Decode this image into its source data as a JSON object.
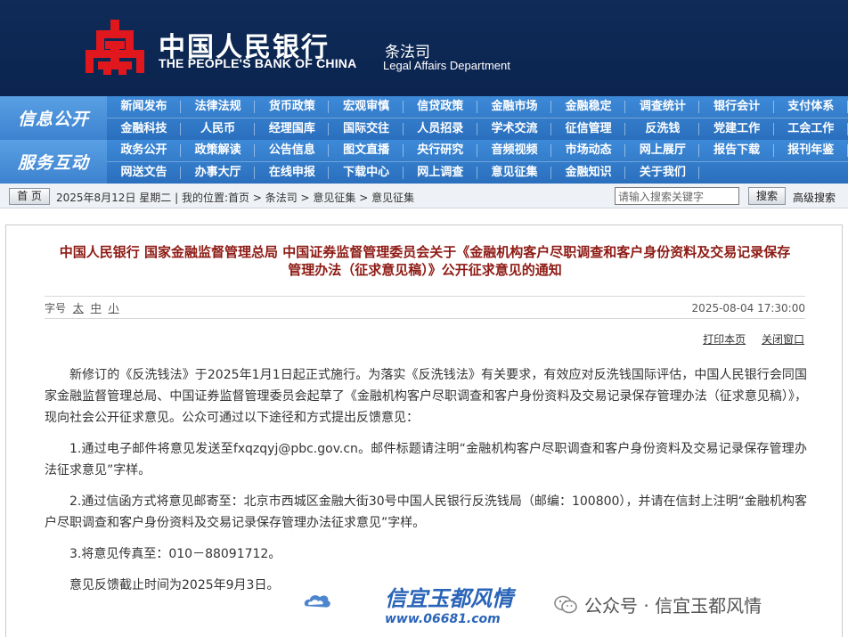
{
  "header": {
    "bank_cn": "中国人民银行",
    "bank_en": "THE PEOPLE'S BANK OF CHINA",
    "dept_cn": "条法司",
    "dept_en": "Legal Affairs Department"
  },
  "nav": {
    "block1": "信息公开",
    "block2": "服务互动",
    "row1": [
      "新闻发布",
      "法律法规",
      "货币政策",
      "宏观审慎",
      "信贷政策",
      "金融市场",
      "金融稳定",
      "调查统计",
      "银行会计",
      "支付体系"
    ],
    "row2": [
      "金融科技",
      "人民币",
      "经理国库",
      "国际交往",
      "人员招录",
      "学术交流",
      "征信管理",
      "反洗钱",
      "党建工作",
      "工会工作"
    ],
    "row3": [
      "政务公开",
      "政策解读",
      "公告信息",
      "图文直播",
      "央行研究",
      "音频视频",
      "市场动态",
      "网上展厅",
      "报告下载",
      "报刊年鉴"
    ],
    "row4": [
      "网送文告",
      "办事大厅",
      "在线申报",
      "下载中心",
      "网上调查",
      "意见征集",
      "金融知识",
      "关于我们"
    ]
  },
  "bar": {
    "home": "首 页",
    "date": "2025年8月12日 星期二",
    "location": "我的位置:首页",
    "crumb1": "条法司",
    "crumb2": "意见征集",
    "crumb3": "意见征集",
    "search_placeholder": "请输入搜索关键字",
    "search_btn": "搜索",
    "advanced": "高级搜索"
  },
  "article": {
    "title_line1": "中国人民银行 国家金融监督管理总局 中国证券监督管理委员会关于《金融机构客户尽职调查和客户身份资料及交易记录保存",
    "title_line2": "管理办法（征求意见稿）》公开征求意见的通知",
    "font_label": "字号",
    "font_big": "太",
    "font_mid": "中",
    "font_small": "小",
    "date": "2025-08-04 17:30:00",
    "print": "打印本页",
    "close": "关闭窗口",
    "p1": "新修订的《反洗钱法》于2025年1月1日起正式施行。为落实《反洗钱法》有关要求，有效应对反洗钱国际评估，中国人民银行会同国家金融监督管理总局、中国证券监督管理委员会起草了《金融机构客户尽职调查和客户身份资料及交易记录保存管理办法（征求意见稿）》，现向社会公开征求意见。公众可通过以下途径和方式提出反馈意见：",
    "p2": "1.通过电子邮件将意见发送至fxqzqyj@pbc.gov.cn。邮件标题请注明“金融机构客户尽职调查和客户身份资料及交易记录保存管理办法征求意见”字样。",
    "p3": "2.通过信函方式将意见邮寄至：北京市西城区金融大街30号中国人民银行反洗钱局（邮编：100800），并请在信封上注明“金融机构客户尽职调查和客户身份资料及交易记录保存管理办法征求意见”字样。",
    "p4": "3.将意见传真至：010－88091712。",
    "p5": "意见反馈截止时间为2025年9月3日。"
  },
  "watermark": {
    "logo_text": "信宜玉都风情",
    "url": "www.06681.com",
    "wechat": "公众号 · 信宜玉都风情"
  }
}
